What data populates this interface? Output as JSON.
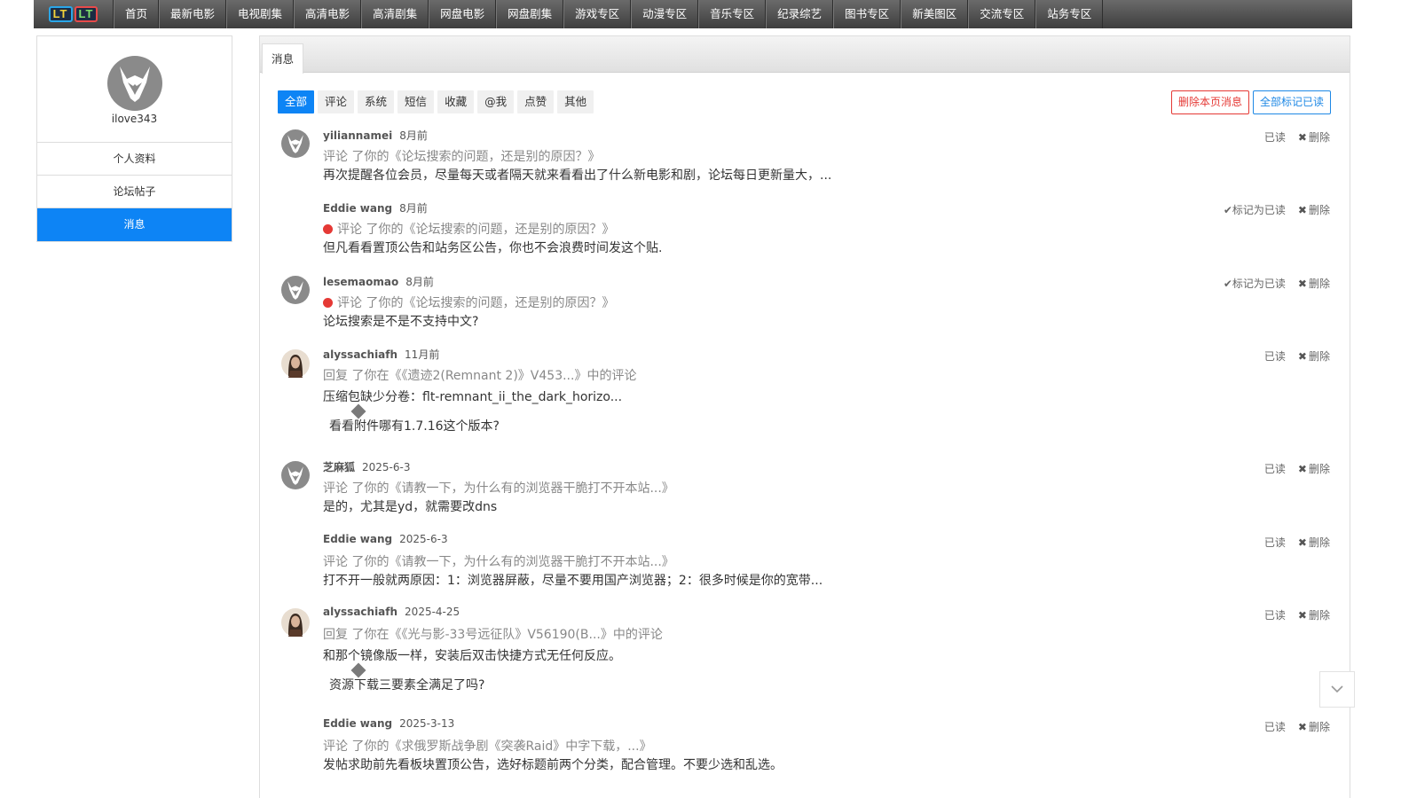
{
  "nav": {
    "logo": [
      "LT",
      "LT"
    ],
    "items": [
      "首页",
      "最新电影",
      "电视剧集",
      "高清电影",
      "高清剧集",
      "网盘电影",
      "网盘剧集",
      "游戏专区",
      "动漫专区",
      "音乐专区",
      "纪录综艺",
      "图书专区",
      "新美图区",
      "交流专区",
      "站务专区"
    ]
  },
  "sidebar": {
    "username": "ilove343",
    "items": [
      "个人资料",
      "论坛帖子",
      "消息"
    ],
    "active": "消息"
  },
  "tab": {
    "label": "消息"
  },
  "filters": {
    "items": [
      "全部",
      "评论",
      "系统",
      "短信",
      "收藏",
      "@我",
      "点赞",
      "其他"
    ],
    "active": "全部"
  },
  "buttons": {
    "delete_page": "删除本页消息",
    "mark_all_read": "全部标记已读"
  },
  "messages": [
    {
      "user": "yiliannamei",
      "time": "8月前",
      "avatar": "horned-avatar",
      "unread": false,
      "action": "评论 了你的《论坛搜索的问题，还是别的原因？》",
      "content": "再次提醒各位会员，尽量每天或者隔天就来看看出了什么新电影和剧，论坛每日更新量大，...",
      "quote": "",
      "read_label": "已读",
      "delete_label": "删除"
    },
    {
      "user": "Eddie wang",
      "time": "8月前",
      "avatar": "",
      "unread": true,
      "action": "评论 了你的《论坛搜索的问题，还是别的原因？》",
      "content": "但凡看看置顶公告和站务区公告，你也不会浪费时间发这个贴.",
      "quote": "",
      "read_label": "标记为已读",
      "delete_label": "删除"
    },
    {
      "user": "lesemaomao",
      "time": "8月前",
      "avatar": "horned-avatar",
      "unread": true,
      "action": "评论 了你的《论坛搜索的问题，还是别的原因？》",
      "content": "论坛搜索是不是不支持中文?",
      "quote": "",
      "read_label": "标记为已读",
      "delete_label": "删除"
    },
    {
      "user": "alyssachiafh",
      "time": "11月前",
      "avatar": "photo-avatar",
      "unread": false,
      "action": "回复 了你在《《遗迹2(Remnant 2)》V453...》中的评论",
      "content": "压缩包缺少分卷：flt-remnant_ii_the_dark_horizo...",
      "quote": "看看附件哪有1.7.16这个版本?",
      "read_label": "已读",
      "delete_label": "删除"
    },
    {
      "user": "芝麻狐",
      "time": "2025-6-3",
      "avatar": "horned-avatar",
      "unread": false,
      "action": "评论 了你的《请教一下，为什么有的浏览器干脆打不开本站...》",
      "content": "是的，尤其是yd，就需要改dns",
      "quote": "",
      "read_label": "已读",
      "delete_label": "删除"
    },
    {
      "user": "Eddie wang",
      "time": "2025-6-3",
      "avatar": "",
      "unread": false,
      "action": "评论 了你的《请教一下，为什么有的浏览器干脆打不开本站...》",
      "content": "打不开一般就两原因：1：浏览器屏蔽，尽量不要用国产浏览器；2：很多时候是你的宽带...",
      "quote": "",
      "read_label": "已读",
      "delete_label": "删除"
    },
    {
      "user": "alyssachiafh",
      "time": "2025-4-25",
      "avatar": "photo-avatar",
      "unread": false,
      "action": "回复 了你在《《光与影-33号远征队》V56190(B...》中的评论",
      "content": "和那个镜像版一样，安装后双击快捷方式无任何反应。",
      "quote": "资源下载三要素全满足了吗?",
      "read_label": "已读",
      "delete_label": "删除"
    },
    {
      "user": "Eddie wang",
      "time": "2025-3-13",
      "avatar": "",
      "unread": false,
      "action": "评论 了你的《求俄罗斯战争剧《突袭Raid》中字下载，...》",
      "content": "发帖求助前先看板块置顶公告，选好标题前两个分类，配合管理。不要少选和乱选。",
      "quote": "",
      "read_label": "已读",
      "delete_label": "删除"
    }
  ],
  "colors": {
    "accent": "#0d84f5",
    "danger": "#e53935",
    "nav_bg": "#4e4e4e"
  }
}
